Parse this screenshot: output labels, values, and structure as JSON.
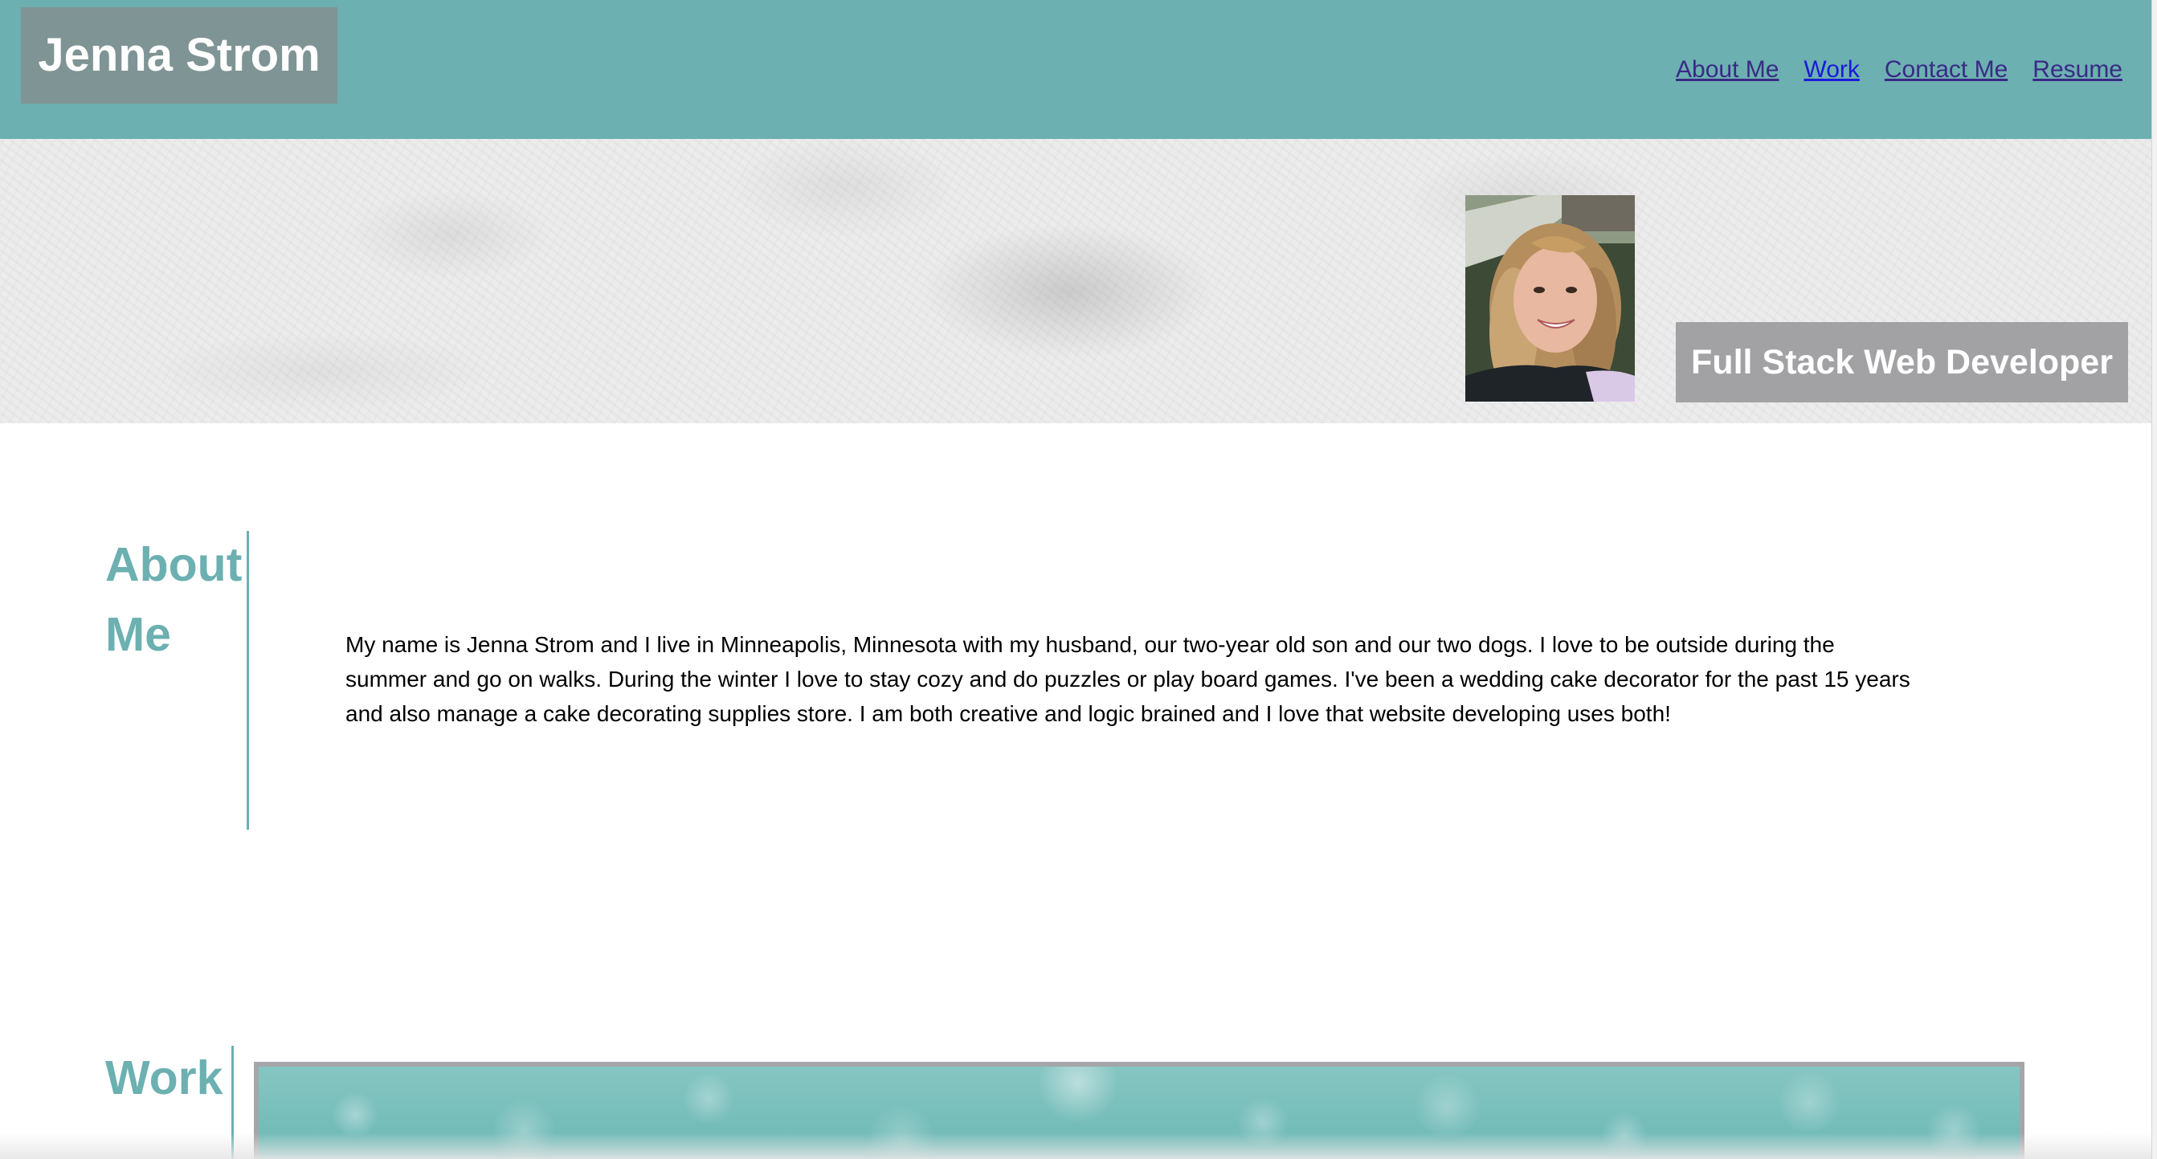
{
  "header": {
    "brand": "Jenna Strom",
    "nav": [
      {
        "label": "About Me"
      },
      {
        "label": "Work"
      },
      {
        "label": "Contact Me"
      },
      {
        "label": "Resume"
      }
    ]
  },
  "hero": {
    "tagline": "Full Stack Web Developer"
  },
  "about": {
    "title": "About Me",
    "body": "My name is Jenna Strom and I live in Minneapolis, Minnesota with my husband, our two-year old son and our two dogs. I love to be outside during the summer and go on walks. During the winter I love to stay cozy and do puzzles or play board games. I've been a wedding cake decorator for the past 15 years and also manage a cake decorating supplies store. I am both creative and logic brained and I love that website developing uses both!"
  },
  "work": {
    "title": "Work"
  },
  "colors": {
    "accent": "#6cb0b1",
    "brand_box": "#7f9494",
    "tagline_box": "#a2a1a4",
    "link": "#3a2a86",
    "link_current": "#1a1ad8"
  }
}
